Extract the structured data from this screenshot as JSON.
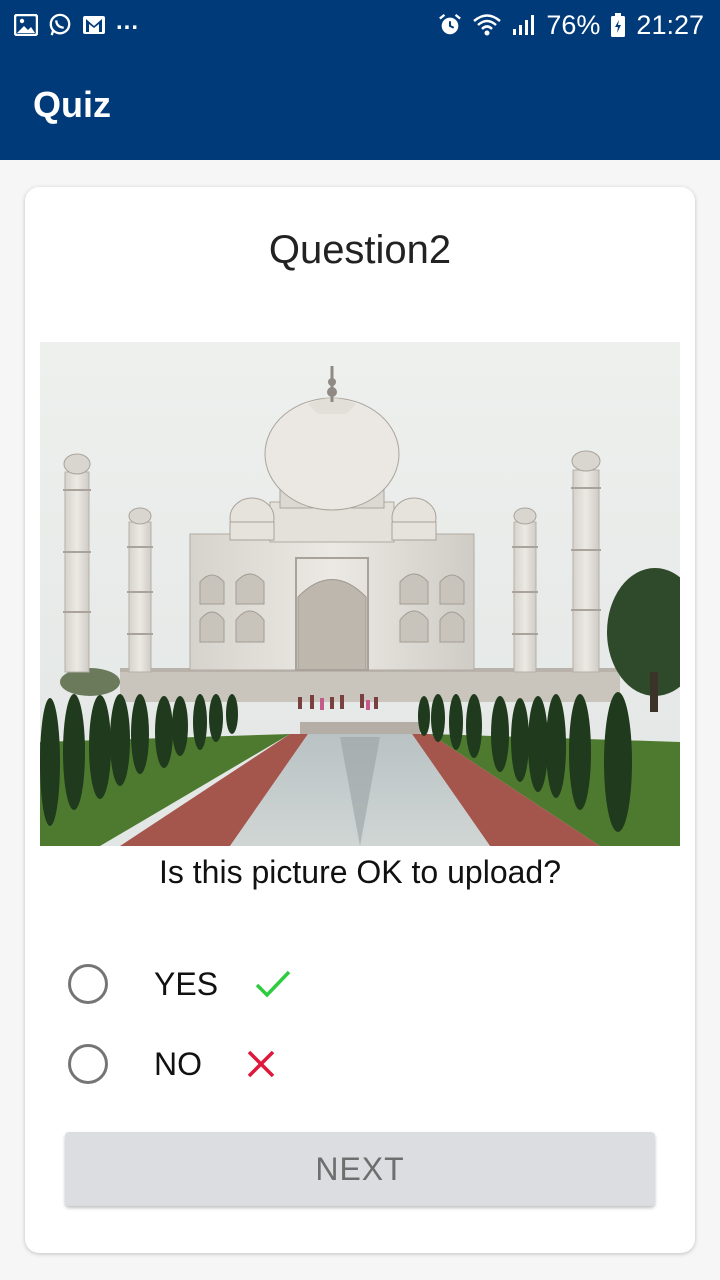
{
  "status_bar": {
    "notification_icons": [
      "gallery-icon",
      "whatsapp-icon",
      "gmail-icon"
    ],
    "overflow": "...",
    "system_icons": [
      "alarm-icon",
      "wifi-icon",
      "signal-icon"
    ],
    "battery": "76%",
    "time": "21:27"
  },
  "app_bar": {
    "title": "Quiz"
  },
  "quiz": {
    "title": "Question2",
    "image_icon": "taj-mahal-photo",
    "question": "Is this picture OK to upload?",
    "options": [
      {
        "label": "YES",
        "icon": "check-icon",
        "icon_color": "#2ecc40",
        "selected": false
      },
      {
        "label": "NO",
        "icon": "cross-icon",
        "icon_color": "#e0163a",
        "selected": false
      }
    ],
    "next_label": "NEXT"
  },
  "colors": {
    "primary": "#013a78",
    "button_bg": "#dcdde0",
    "button_text": "#6e6e6e",
    "radio_border": "#757575"
  }
}
